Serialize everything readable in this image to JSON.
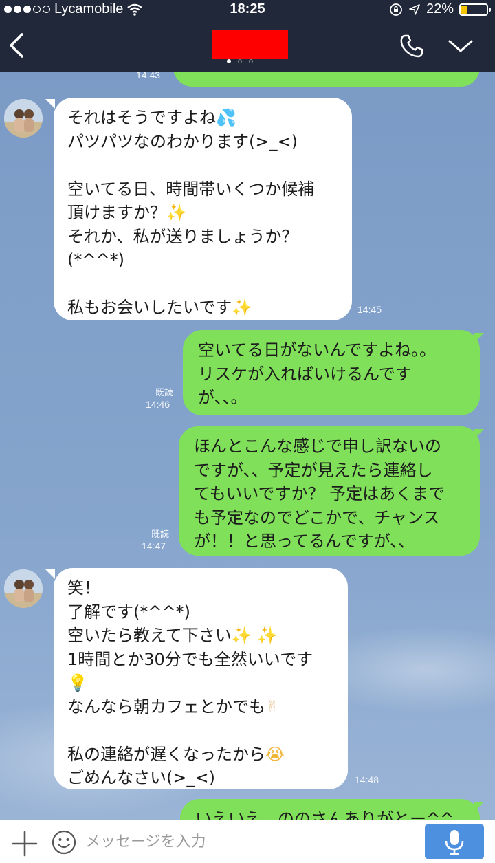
{
  "status_bar": {
    "carrier": "Lycamobile",
    "time": "18:25",
    "battery_percent": "22%",
    "battery_level": 0.22,
    "icons": [
      "signal-icon",
      "wifi-icon",
      "rotation-lock-icon",
      "location-icon",
      "battery-icon"
    ]
  },
  "header": {
    "icons": [
      "chevron-left-icon",
      "phone-icon",
      "chevron-down-icon"
    ],
    "page_indicator_count": 3
  },
  "messages": [
    {
      "dir": "out",
      "time": "14:43"
    },
    {
      "dir": "in",
      "time": "14:45",
      "lines": [
        "それはそうですよね",
        "パツパツなのわかります(>_<)",
        "",
        "空いてる日、時間帯いくつか候補",
        "頂けますか？",
        "それか、私が送りましょうか？",
        "(*^^*)",
        "",
        "私もお会いしたいです"
      ]
    },
    {
      "dir": "out",
      "read": "既読",
      "time": "14:46",
      "lines": [
        "空いてる日がないんですよね。。",
        "リスケが入ればいけるんです",
        "が、、。"
      ]
    },
    {
      "dir": "out",
      "read": "既読",
      "time": "14:47",
      "lines": [
        "ほんとこんな感じで申し訳ないの",
        "ですが、、予定が見えたら連絡し",
        "てもいいですか？ 予定はあくまで",
        "も予定なのでどこかで、チャンス",
        "が！！と思ってるんですが、、"
      ]
    },
    {
      "dir": "in",
      "time": "14:48",
      "lines": [
        "笑！",
        "了解です(*^^*)",
        "空いたら教えて下さい",
        "1時間とか30分でも全然いいです",
        "",
        "なんなら朝カフェとかでも",
        "",
        "私の連絡が遅くなったから",
        "ごめんなさい(>_<)"
      ]
    },
    {
      "dir": "out",
      "partial_text": "いえいえ、ののさんありがとー^^"
    }
  ],
  "emoji": {
    "sweat_drops": "💦",
    "sparkles": "✨",
    "light_bulb": "💡",
    "victory_hand": "✌",
    "crying_face": "😭"
  },
  "input": {
    "placeholder": "メッセージを入力"
  },
  "colors": {
    "header_bg": "#20283a",
    "outgoing_bubble": "#80e05a",
    "incoming_bubble": "#ffffff",
    "mic_button": "#4e90e0",
    "battery_fill": "#f5c400",
    "redaction": "#ff0000"
  }
}
